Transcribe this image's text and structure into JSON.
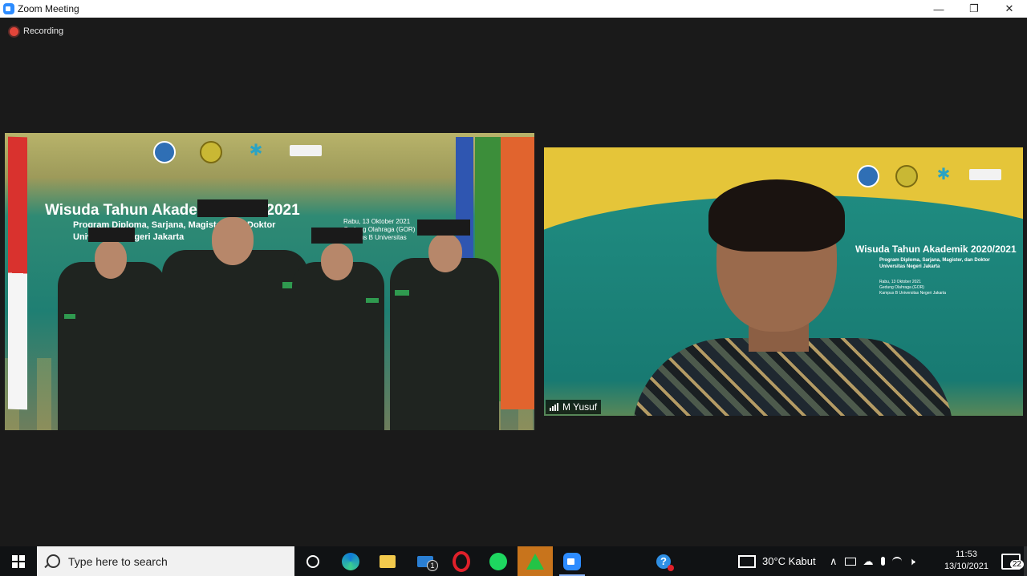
{
  "window": {
    "title": "Zoom Meeting",
    "minimize_symbol": "—",
    "restore_symbol": "❐",
    "close_symbol": "✕"
  },
  "meeting": {
    "recording_label": "Recording"
  },
  "participants": [
    {
      "banner": {
        "title": "Wisuda Tahun Akademik 2020/2021",
        "line1": "Program Diploma, Sarjana, Magister, dan Doktor",
        "line2": "Universitas Negeri Jakarta",
        "date_line1": "Rabu, 13 Oktober 2021",
        "date_line2": "Gedung Olahraga (GOR)",
        "date_line3": "Kampus B Universitas"
      }
    },
    {
      "name": "M Yusuf",
      "banner": {
        "title": "Wisuda Tahun Akademik 2020/2021",
        "line1": "Program Diploma, Sarjana, Magister, dan Doktor",
        "line2": "Universitas Negeri Jakarta",
        "date_line1": "Rabu, 13 Oktober 2021",
        "date_line2": "Gedung Olahraga (GOR)",
        "date_line3": "Kampus B Universitas Negeri Jakarta"
      }
    }
  ],
  "taskbar": {
    "search_placeholder": "Type here to search",
    "mail_badge": "1",
    "weather": "30°C  Kabut",
    "time": "11:53",
    "date": "13/10/2021",
    "notification_count": "22",
    "colors": {
      "background": "#101214",
      "search_bg": "#f1f1f1",
      "active_app": "#c8741c"
    }
  }
}
